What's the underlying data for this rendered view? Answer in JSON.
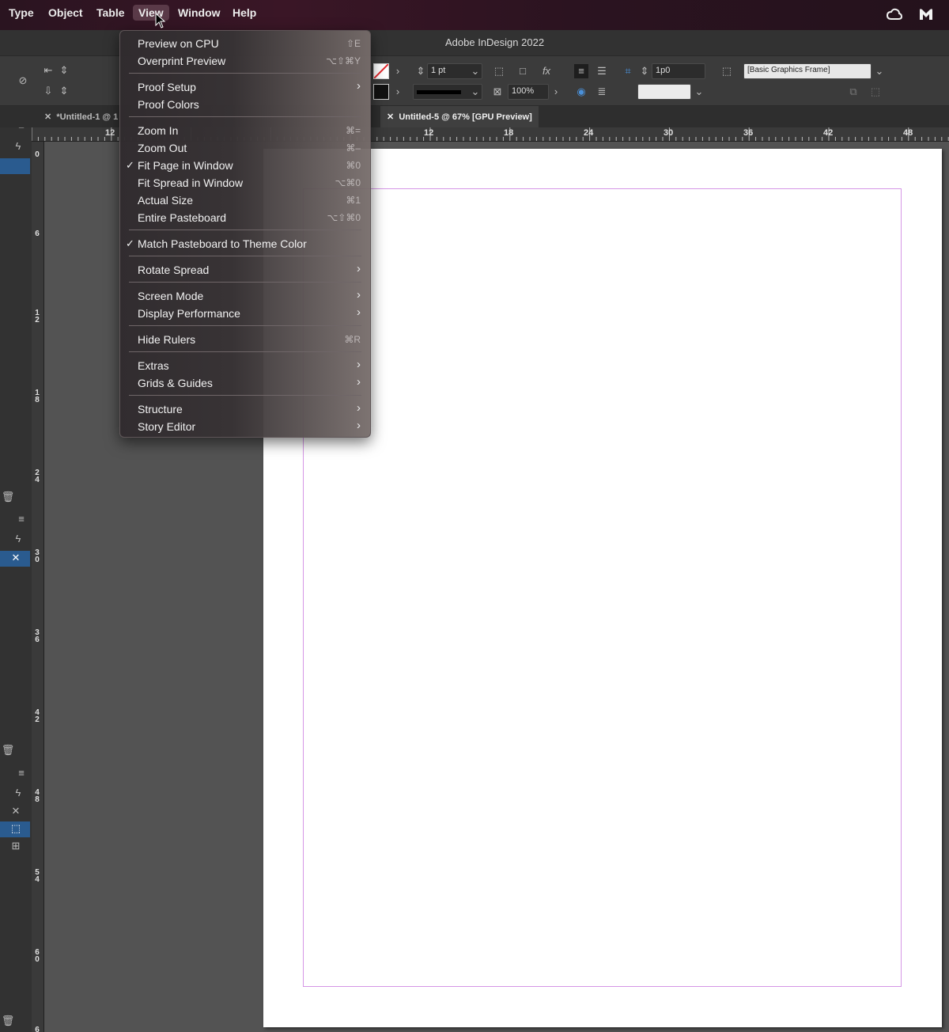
{
  "menubar": {
    "items": [
      "Type",
      "Object",
      "Table",
      "View",
      "Window",
      "Help"
    ],
    "active": "View",
    "tray_icons": [
      "creative-cloud-icon",
      "malwarebytes-icon"
    ]
  },
  "app": {
    "title": "Adobe InDesign 2022"
  },
  "control_bar": {
    "stroke_weight": "1 pt",
    "opacity": "100%",
    "gap": "1p0",
    "object_style": "[Basic Graphics Frame]"
  },
  "tabs": [
    {
      "label": "*Untitled-1 @ 1",
      "active": false
    },
    {
      "label": "Untitled-5 @ 67% [GPU Preview]",
      "active": true
    }
  ],
  "rulers": {
    "horizontal": [
      "12",
      "12",
      "18",
      "24",
      "30",
      "36",
      "42",
      "48"
    ],
    "vertical": [
      "0",
      "6",
      "1 2",
      "1 8",
      "2 4",
      "3 0",
      "3 6",
      "4 2",
      "4 8",
      "5 4",
      "6 0",
      "6"
    ]
  },
  "view_menu": {
    "groups": [
      [
        {
          "label": "Preview on CPU",
          "shortcut": "⇧E"
        },
        {
          "label": "Overprint Preview",
          "shortcut": "⌥⇧⌘Y"
        }
      ],
      [
        {
          "label": "Proof Setup",
          "submenu": true
        },
        {
          "label": "Proof Colors",
          "shortcut": ""
        }
      ],
      [
        {
          "label": "Zoom In",
          "shortcut": "⌘="
        },
        {
          "label": "Zoom Out",
          "shortcut": "⌘–"
        },
        {
          "label": "Fit Page in Window",
          "shortcut": "⌘0",
          "checked": true
        },
        {
          "label": "Fit Spread in Window",
          "shortcut": "⌥⌘0"
        },
        {
          "label": "Actual Size",
          "shortcut": "⌘1"
        },
        {
          "label": "Entire Pasteboard",
          "shortcut": "⌥⇧⌘0"
        }
      ],
      [
        {
          "label": "Match Pasteboard to Theme Color",
          "checked": true
        }
      ],
      [
        {
          "label": "Rotate Spread",
          "submenu": true
        }
      ],
      [
        {
          "label": "Screen Mode",
          "submenu": true
        },
        {
          "label": "Display Performance",
          "submenu": true
        }
      ],
      [
        {
          "label": "Hide Rulers",
          "shortcut": "⌘R"
        }
      ],
      [
        {
          "label": "Extras",
          "submenu": true
        },
        {
          "label": "Grids & Guides",
          "submenu": true
        }
      ],
      [
        {
          "label": "Structure",
          "submenu": true
        },
        {
          "label": "Story Editor",
          "submenu": true
        }
      ]
    ]
  },
  "colors": {
    "accent_selection": "#2a5b8f",
    "margin_guide": "#d596e6",
    "page": "#ffffff",
    "pasteboard": "#535353"
  }
}
